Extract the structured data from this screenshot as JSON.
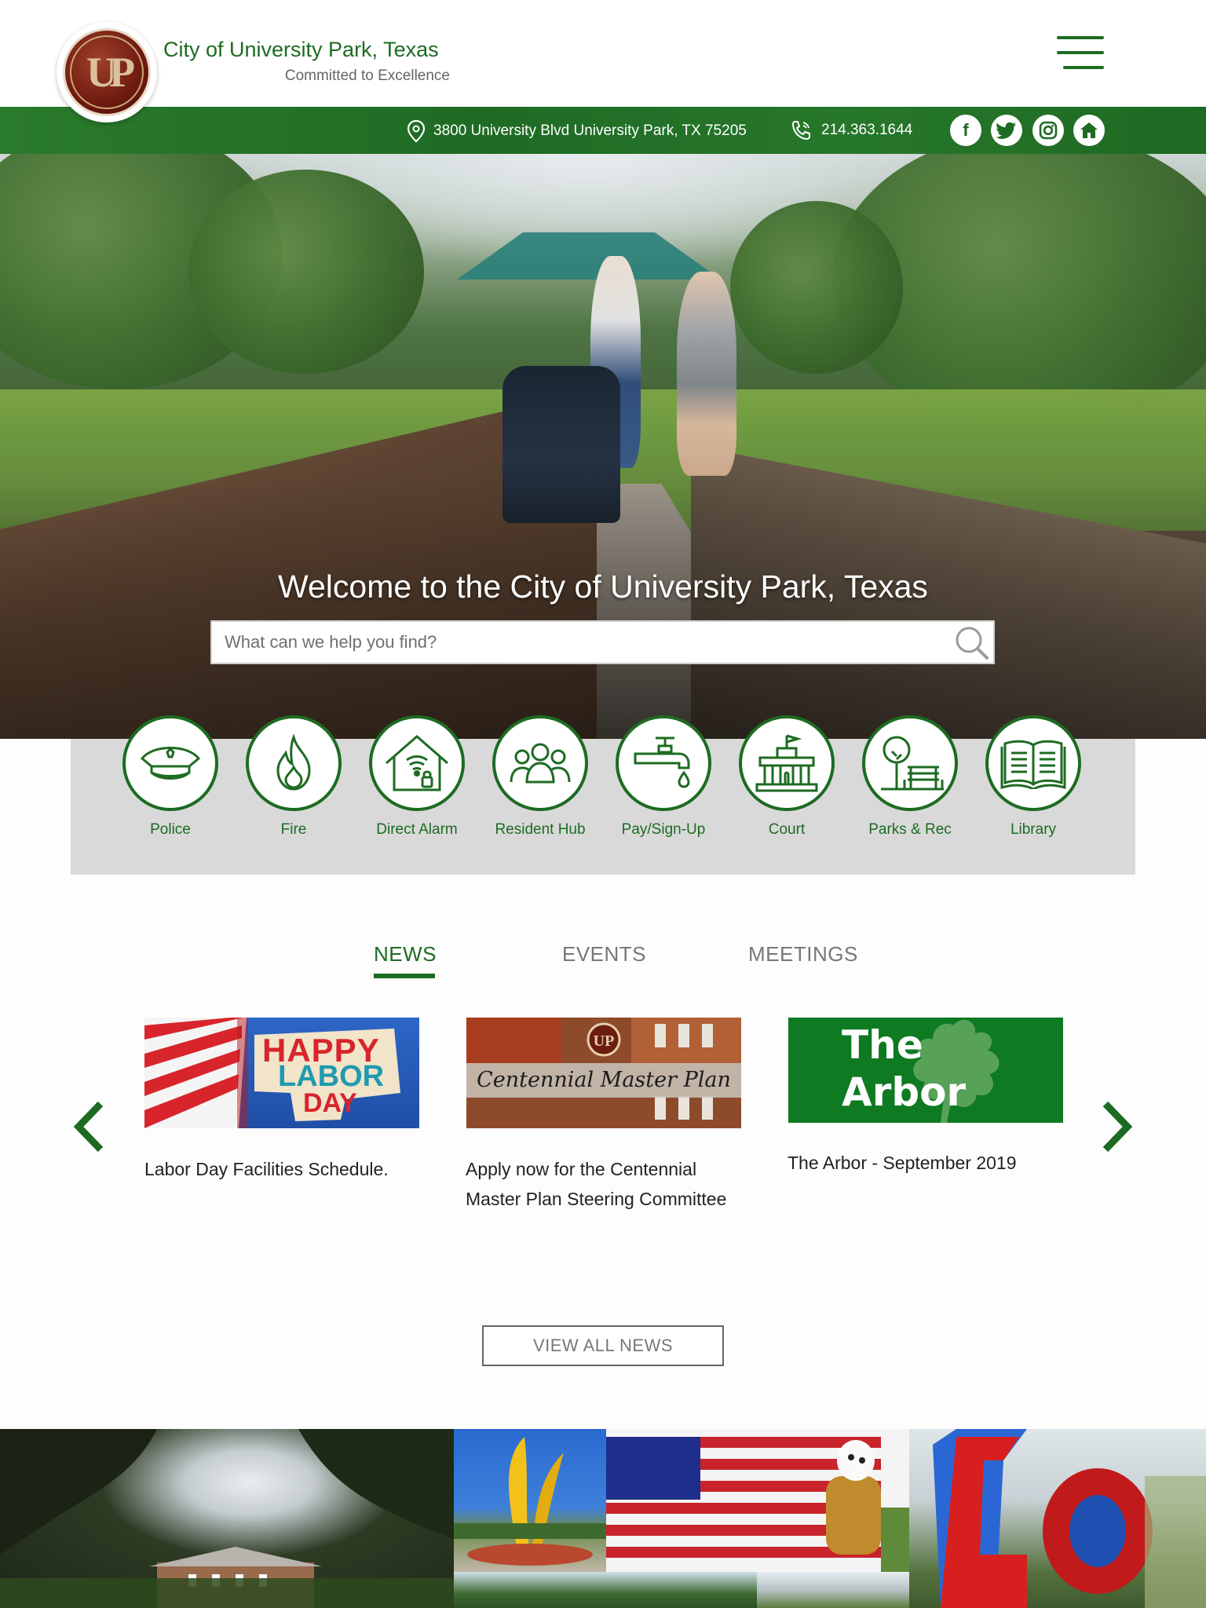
{
  "header": {
    "title": "City of University Park, Texas",
    "tagline": "Committed to Excellence",
    "logo_letters": "UP"
  },
  "contact": {
    "address": "3800 University Blvd University Park, TX 75205",
    "phone": "214.363.1644"
  },
  "social": [
    "facebook-icon",
    "twitter-icon",
    "instagram-icon",
    "nextdoor-icon"
  ],
  "hero": {
    "title": "Welcome to the City of University Park, Texas",
    "search_placeholder": "What can we help you find?"
  },
  "quick_links": [
    {
      "label": "Police",
      "icon": "police-cap-icon"
    },
    {
      "label": "Fire",
      "icon": "flame-icon"
    },
    {
      "label": "Direct Alarm",
      "icon": "house-alarm-icon"
    },
    {
      "label": "Resident Hub",
      "icon": "people-group-icon"
    },
    {
      "label": "Pay/Sign-Up",
      "icon": "water-faucet-icon"
    },
    {
      "label": "Court",
      "icon": "courthouse-icon"
    },
    {
      "label": "Parks & Rec",
      "icon": "park-bench-icon"
    },
    {
      "label": "Library",
      "icon": "open-book-icon"
    }
  ],
  "tabs": [
    {
      "label": "NEWS",
      "active": true
    },
    {
      "label": "EVENTS",
      "active": false
    },
    {
      "label": "MEETINGS",
      "active": false
    }
  ],
  "news": [
    {
      "title": "Labor Day Facilities Schedule.",
      "image_text": [
        "HAPPY",
        "LABOR",
        "DAY"
      ]
    },
    {
      "title": "Apply now for the Centennial Master Plan Steering Committee",
      "image_text": [
        "Centennial Master Plan"
      ]
    },
    {
      "title": "The Arbor - September 2019",
      "image_text": [
        "The",
        "Arbor"
      ]
    }
  ],
  "view_all_label": "VIEW ALL NEWS",
  "colors": {
    "brand_green": "#1d6b22",
    "quick_bg": "#d9d9d9",
    "arbor_green": "#0e7a22"
  }
}
